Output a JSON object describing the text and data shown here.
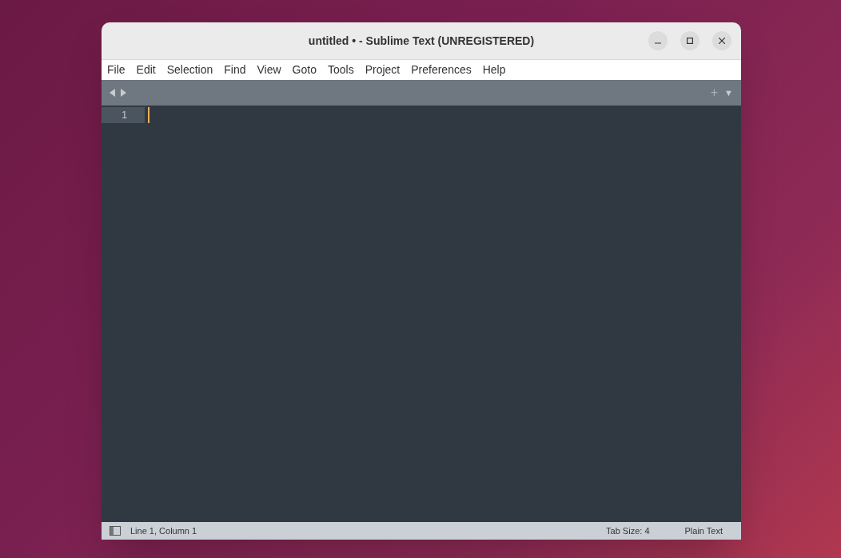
{
  "window": {
    "title": "untitled • - Sublime Text (UNREGISTERED)"
  },
  "menu": [
    "File",
    "Edit",
    "Selection",
    "Find",
    "View",
    "Goto",
    "Tools",
    "Project",
    "Preferences",
    "Help"
  ],
  "tab_bar": {
    "new_tab": "+",
    "menu": "▼"
  },
  "editor": {
    "line_numbers": [
      "1"
    ]
  },
  "status_bar": {
    "position": "Line 1, Column 1",
    "tab_size": "Tab Size: 4",
    "syntax": "Plain Text"
  }
}
